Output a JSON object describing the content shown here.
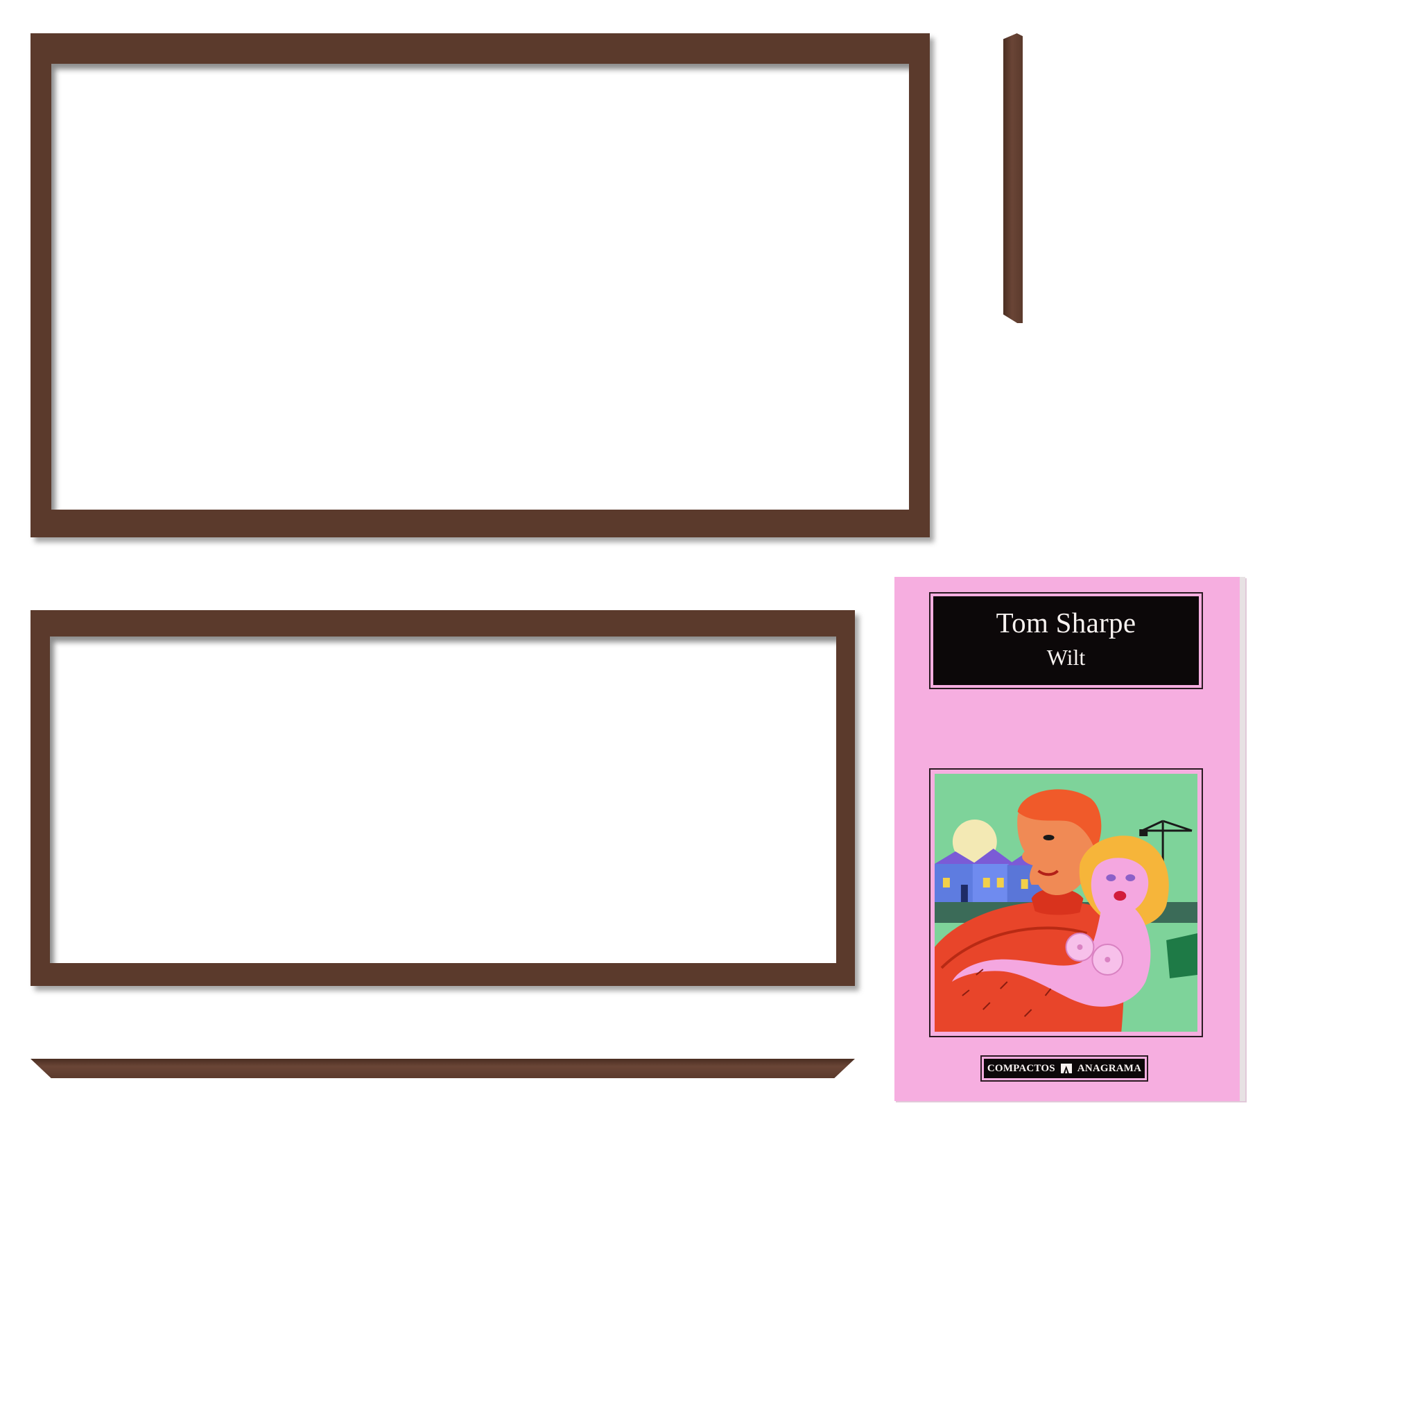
{
  "book": {
    "author": "Tom Sharpe",
    "title": "Wilt",
    "collection": "COMPACTOS",
    "publisher": "ANAGRAMA",
    "cover_color": "#f6aee0",
    "publisher_logo_icon": "anagrama-logo-icon"
  },
  "colors": {
    "frame_wood": "#5b3a2c",
    "background": "#ffffff"
  }
}
